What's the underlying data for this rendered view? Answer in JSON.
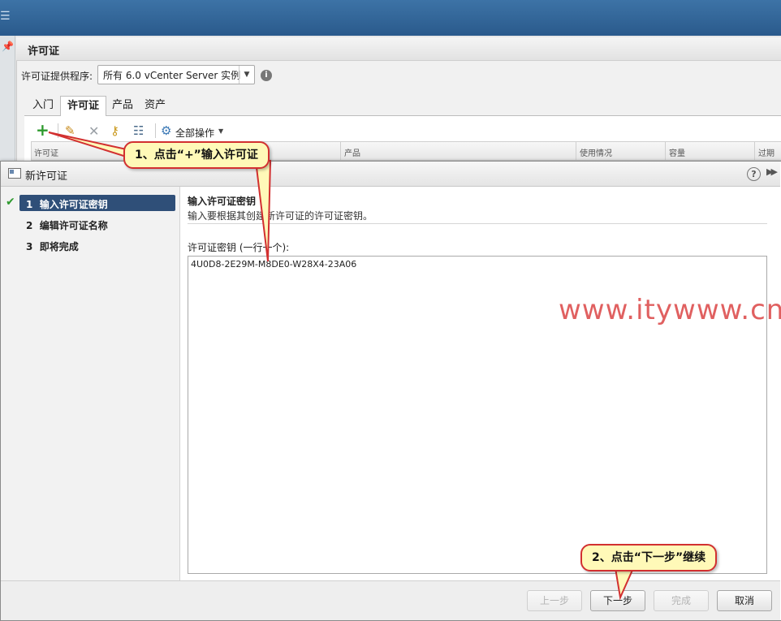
{
  "topbar": {
    "icon": "hamburger-menu-icon",
    "icon_glyph": "☰"
  },
  "background": {
    "title": "许可证",
    "provider_label": "许可证提供程序:",
    "provider_value": "所有 6.0 vCenter Server 实例",
    "tabs": [
      "入门",
      "许可证",
      "产品",
      "资产"
    ],
    "active_tab": "许可证",
    "toolbar": {
      "all_actions": "全部操作"
    },
    "grid_columns": [
      "许可证",
      "产品",
      "使用情况",
      "容量",
      "过期"
    ]
  },
  "dialog": {
    "title": "新许可证",
    "steps": [
      {
        "num": "1",
        "label": "输入许可证密钥",
        "active": true,
        "done": true
      },
      {
        "num": "2",
        "label": "编辑许可证名称",
        "active": false,
        "done": false
      },
      {
        "num": "3",
        "label": "即将完成",
        "active": false,
        "done": false
      }
    ],
    "content": {
      "title": "输入许可证密钥",
      "description": "输入要根据其创建新许可证的许可证密钥。",
      "keys_label": "许可证密钥 (一行一个):",
      "keys_value": "4U0D8-2E29M-M8DE0-W28X4-23A06"
    },
    "buttons": {
      "back": "上一步",
      "next": "下一步",
      "finish": "完成",
      "cancel": "取消"
    }
  },
  "annotations": {
    "callout1": "1、点击“+”输入许可证",
    "callout2": "2、点击“下一步”继续",
    "watermark": "www.itywww.cn",
    "callout_border_color": "#d23030",
    "callout_fill_color": "#fff9b8"
  }
}
